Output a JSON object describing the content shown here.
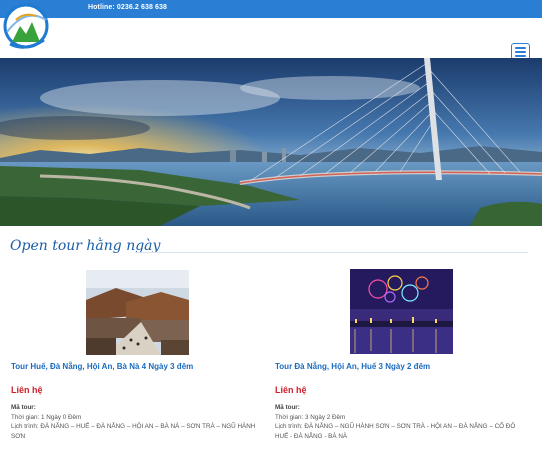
{
  "topbar": {
    "hotline": "Hotline: 0236.2 638 638"
  },
  "section": {
    "title": "Open tour hằng ngày"
  },
  "tours": [
    {
      "name": "Tour Huế, Đà Nẵng, Hội An, Bà Nà 4 Ngày 3 đêm",
      "contact": "Liên hệ",
      "code_label": "Mã tour:",
      "time_label": "Thời gian:",
      "time_value": "1 Ngày 0 Đêm",
      "schedule_label": "Lịch trình:",
      "schedule_value": "ĐÀ NẴNG – HUẾ – ĐÀ NẴNG – HỘI AN – BÀ NÀ – SƠN TRÀ – NGŨ HÀNH SƠN"
    },
    {
      "name": "Tour Đà Nẵng, Hội An, Huế 3 Ngày 2 đêm",
      "contact": "Liên hệ",
      "code_label": "Mã tour:",
      "time_label": "Thời gian:",
      "time_value": "3 Ngày 2 Đêm",
      "schedule_label": "Lịch trình:",
      "schedule_value": "ĐÀ NẴNG – NGŨ HÀNH SƠN – SƠN TRÀ - HỘI AN – ĐÀ NẴNG – CỐ ĐÔ HUẾ - ĐÀ NẴNG - BÀ NÀ"
    }
  ],
  "colors": {
    "topbar": "#2a7fd4",
    "link": "#1a6bbf",
    "contact": "#d0212b",
    "title": "#1a5ea8"
  }
}
